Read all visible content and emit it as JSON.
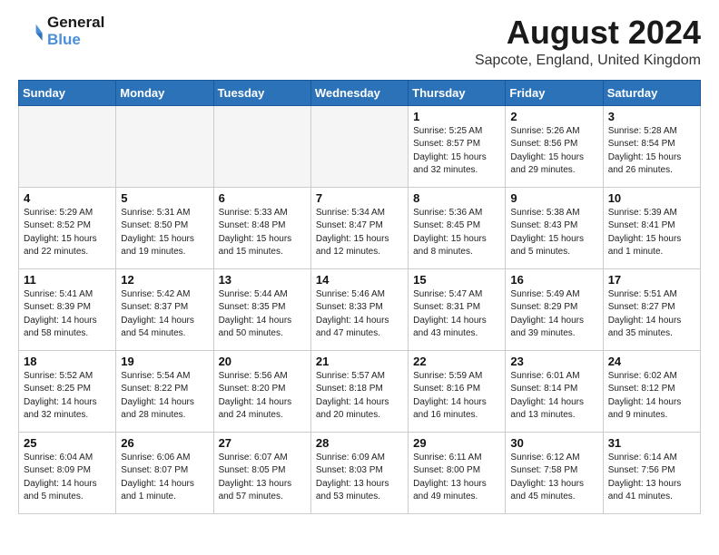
{
  "logo": {
    "line1": "General",
    "line2": "Blue"
  },
  "title": {
    "month_year": "August 2024",
    "location": "Sapcote, England, United Kingdom"
  },
  "days_of_week": [
    "Sunday",
    "Monday",
    "Tuesday",
    "Wednesday",
    "Thursday",
    "Friday",
    "Saturday"
  ],
  "weeks": [
    [
      {
        "date": "",
        "info": ""
      },
      {
        "date": "",
        "info": ""
      },
      {
        "date": "",
        "info": ""
      },
      {
        "date": "",
        "info": ""
      },
      {
        "date": "1",
        "info": "Sunrise: 5:25 AM\nSunset: 8:57 PM\nDaylight: 15 hours\nand 32 minutes."
      },
      {
        "date": "2",
        "info": "Sunrise: 5:26 AM\nSunset: 8:56 PM\nDaylight: 15 hours\nand 29 minutes."
      },
      {
        "date": "3",
        "info": "Sunrise: 5:28 AM\nSunset: 8:54 PM\nDaylight: 15 hours\nand 26 minutes."
      }
    ],
    [
      {
        "date": "4",
        "info": "Sunrise: 5:29 AM\nSunset: 8:52 PM\nDaylight: 15 hours\nand 22 minutes."
      },
      {
        "date": "5",
        "info": "Sunrise: 5:31 AM\nSunset: 8:50 PM\nDaylight: 15 hours\nand 19 minutes."
      },
      {
        "date": "6",
        "info": "Sunrise: 5:33 AM\nSunset: 8:48 PM\nDaylight: 15 hours\nand 15 minutes."
      },
      {
        "date": "7",
        "info": "Sunrise: 5:34 AM\nSunset: 8:47 PM\nDaylight: 15 hours\nand 12 minutes."
      },
      {
        "date": "8",
        "info": "Sunrise: 5:36 AM\nSunset: 8:45 PM\nDaylight: 15 hours\nand 8 minutes."
      },
      {
        "date": "9",
        "info": "Sunrise: 5:38 AM\nSunset: 8:43 PM\nDaylight: 15 hours\nand 5 minutes."
      },
      {
        "date": "10",
        "info": "Sunrise: 5:39 AM\nSunset: 8:41 PM\nDaylight: 15 hours\nand 1 minute."
      }
    ],
    [
      {
        "date": "11",
        "info": "Sunrise: 5:41 AM\nSunset: 8:39 PM\nDaylight: 14 hours\nand 58 minutes."
      },
      {
        "date": "12",
        "info": "Sunrise: 5:42 AM\nSunset: 8:37 PM\nDaylight: 14 hours\nand 54 minutes."
      },
      {
        "date": "13",
        "info": "Sunrise: 5:44 AM\nSunset: 8:35 PM\nDaylight: 14 hours\nand 50 minutes."
      },
      {
        "date": "14",
        "info": "Sunrise: 5:46 AM\nSunset: 8:33 PM\nDaylight: 14 hours\nand 47 minutes."
      },
      {
        "date": "15",
        "info": "Sunrise: 5:47 AM\nSunset: 8:31 PM\nDaylight: 14 hours\nand 43 minutes."
      },
      {
        "date": "16",
        "info": "Sunrise: 5:49 AM\nSunset: 8:29 PM\nDaylight: 14 hours\nand 39 minutes."
      },
      {
        "date": "17",
        "info": "Sunrise: 5:51 AM\nSunset: 8:27 PM\nDaylight: 14 hours\nand 35 minutes."
      }
    ],
    [
      {
        "date": "18",
        "info": "Sunrise: 5:52 AM\nSunset: 8:25 PM\nDaylight: 14 hours\nand 32 minutes."
      },
      {
        "date": "19",
        "info": "Sunrise: 5:54 AM\nSunset: 8:22 PM\nDaylight: 14 hours\nand 28 minutes."
      },
      {
        "date": "20",
        "info": "Sunrise: 5:56 AM\nSunset: 8:20 PM\nDaylight: 14 hours\nand 24 minutes."
      },
      {
        "date": "21",
        "info": "Sunrise: 5:57 AM\nSunset: 8:18 PM\nDaylight: 14 hours\nand 20 minutes."
      },
      {
        "date": "22",
        "info": "Sunrise: 5:59 AM\nSunset: 8:16 PM\nDaylight: 14 hours\nand 16 minutes."
      },
      {
        "date": "23",
        "info": "Sunrise: 6:01 AM\nSunset: 8:14 PM\nDaylight: 14 hours\nand 13 minutes."
      },
      {
        "date": "24",
        "info": "Sunrise: 6:02 AM\nSunset: 8:12 PM\nDaylight: 14 hours\nand 9 minutes."
      }
    ],
    [
      {
        "date": "25",
        "info": "Sunrise: 6:04 AM\nSunset: 8:09 PM\nDaylight: 14 hours\nand 5 minutes."
      },
      {
        "date": "26",
        "info": "Sunrise: 6:06 AM\nSunset: 8:07 PM\nDaylight: 14 hours\nand 1 minute."
      },
      {
        "date": "27",
        "info": "Sunrise: 6:07 AM\nSunset: 8:05 PM\nDaylight: 13 hours\nand 57 minutes."
      },
      {
        "date": "28",
        "info": "Sunrise: 6:09 AM\nSunset: 8:03 PM\nDaylight: 13 hours\nand 53 minutes."
      },
      {
        "date": "29",
        "info": "Sunrise: 6:11 AM\nSunset: 8:00 PM\nDaylight: 13 hours\nand 49 minutes."
      },
      {
        "date": "30",
        "info": "Sunrise: 6:12 AM\nSunset: 7:58 PM\nDaylight: 13 hours\nand 45 minutes."
      },
      {
        "date": "31",
        "info": "Sunrise: 6:14 AM\nSunset: 7:56 PM\nDaylight: 13 hours\nand 41 minutes."
      }
    ]
  ]
}
